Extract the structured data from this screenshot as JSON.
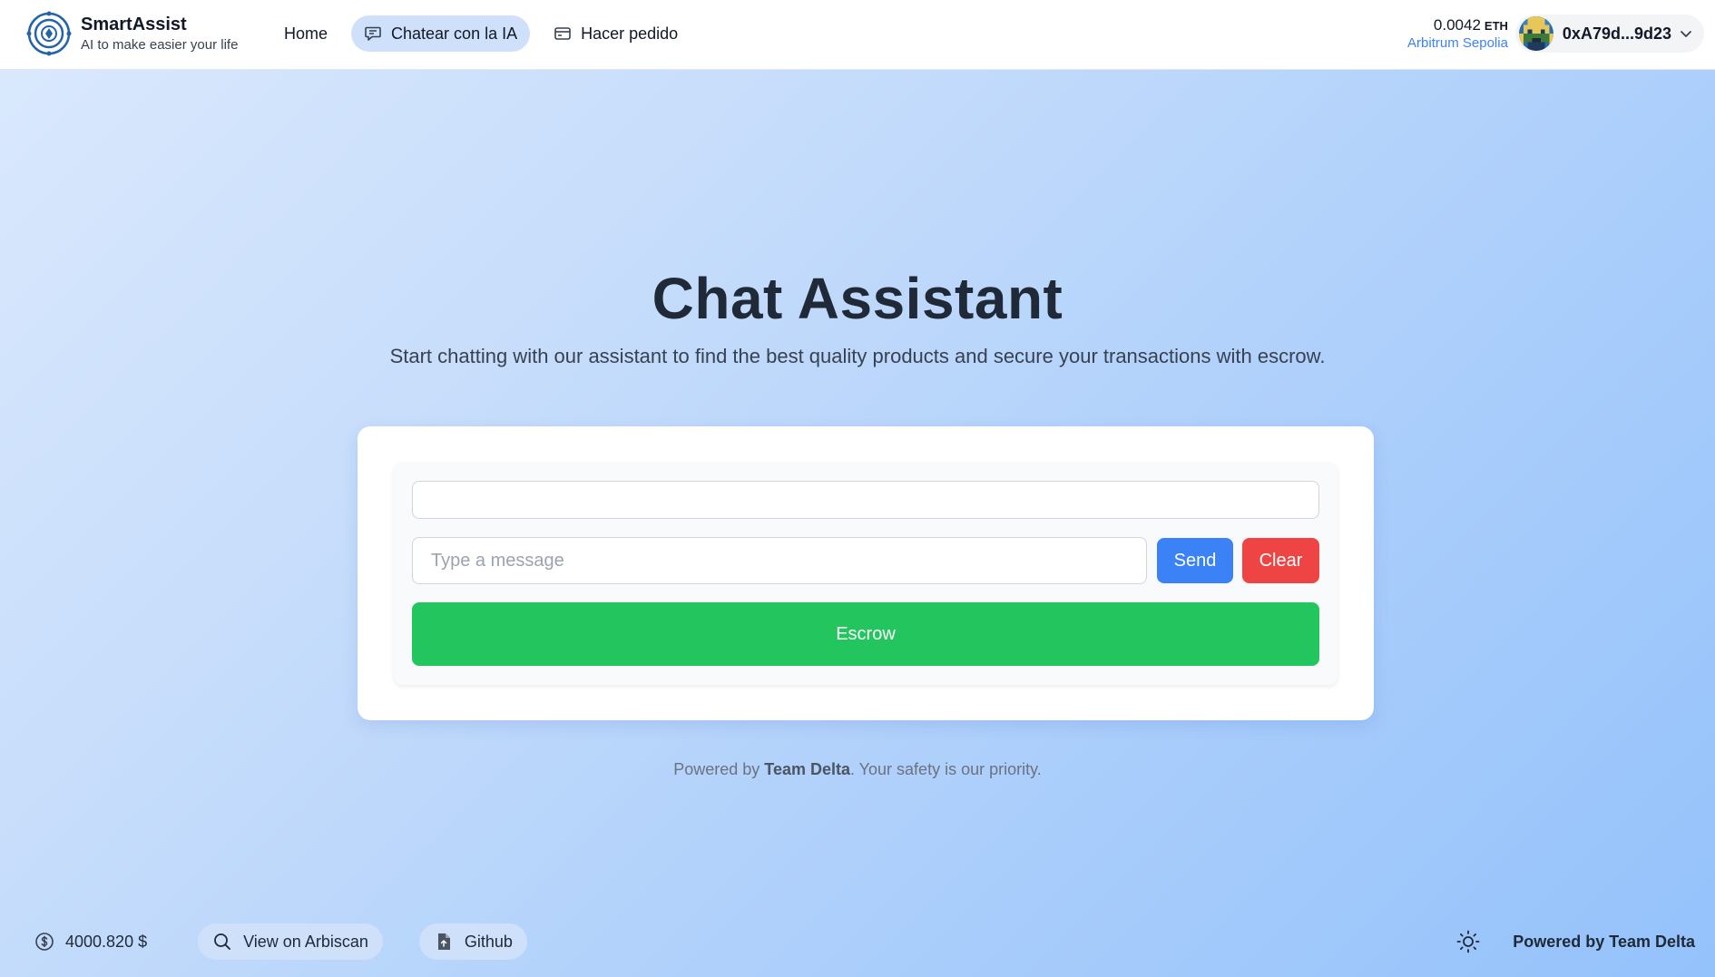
{
  "brand": {
    "name": "SmartAssist",
    "tagline": "AI to make easier your life"
  },
  "nav": {
    "home": "Home",
    "chat": "Chatear con la IA",
    "order": "Hacer pedido"
  },
  "wallet": {
    "balance": "0.0042",
    "unit": "ETH",
    "network": "Arbitrum Sepolia",
    "address": "0xA79d...9d23"
  },
  "main": {
    "title": "Chat Assistant",
    "subtitle": "Start chatting with our assistant to find the best quality products and secure your transactions with escrow.",
    "input_placeholder": "Type a message",
    "send_label": "Send",
    "clear_label": "Clear",
    "escrow_label": "Escrow",
    "powered_prefix": "Powered by ",
    "powered_team": "Team Delta",
    "powered_suffix": ". Your safety is our priority."
  },
  "footer": {
    "price": "4000.820 $",
    "arbiscan": "View on Arbiscan",
    "github": "Github",
    "powered": "Powered by Team Delta"
  },
  "colors": {
    "primary": "#3b82f6",
    "danger": "#ef4444",
    "success": "#22c55e",
    "nav_active": "#cfe0fb"
  },
  "icons": {
    "logo": "smartassist-logo",
    "chat": "chat-bubble-icon",
    "order": "card-icon",
    "chevron": "chevron-down-icon",
    "price": "dollar-circle-icon",
    "search": "search-icon",
    "github": "file-icon",
    "theme": "sun-icon"
  }
}
